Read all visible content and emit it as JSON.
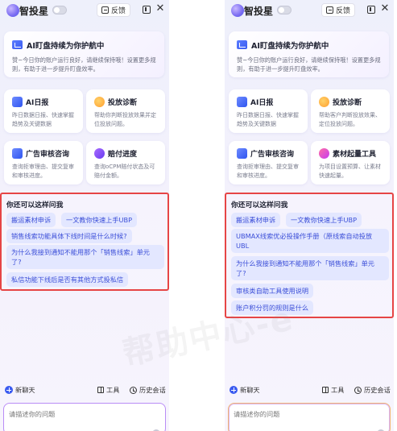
{
  "left": {
    "app_title": "智投星",
    "feedback_label": "反馈",
    "banner": {
      "title": "AI盯盘持续为你护航中",
      "desc": "赞~今日你的账户运行良好，请继续保持哦！设置更多规则，有助于进一步提升盯盘效率。"
    },
    "cards": [
      {
        "title": "AI日报",
        "desc": "昨日数据日报、快速掌握趋势及关键数据",
        "icon": "report-icon"
      },
      {
        "title": "投放诊断",
        "desc": "帮助你判断投放效果并定位投放问题。",
        "icon": "diagnosis-icon"
      },
      {
        "title": "广告审核咨询",
        "desc": "查询拒审理由、提交复审和审核进度。",
        "icon": "review-icon"
      },
      {
        "title": "赔付进度",
        "desc": "查询oCPM赔付状态及可赔付金额。",
        "icon": "compensation-icon"
      }
    ],
    "questions_title": "你还可以这样问我",
    "questions": [
      "搬运素材申诉",
      "一文教你快速上手UBP",
      "销售线索功能具体下线时间是什么时候?",
      "为什么我接到通知不能用那个「销售线索」单元了?",
      "私信功能下线后是否有其他方式投私信"
    ],
    "footer": {
      "new_chat": "新聊天",
      "tools": "工具",
      "history": "历史会话"
    },
    "input_placeholder": "请描述你的问题"
  },
  "right": {
    "app_title": "智投星",
    "feedback_label": "反馈",
    "banner": {
      "title": "AI盯盘持续为你护航中",
      "desc": "赞~今日你的账户运行良好，请继续保持哦！设置更多规则，有助于进一步提升盯盘效率。"
    },
    "cards": [
      {
        "title": "AI日报",
        "desc": "昨日数据日报、快速掌握趋势及关键数据",
        "icon": "report-icon"
      },
      {
        "title": "投放诊断",
        "desc": "帮助客户判断投放效果、定位投放问题。",
        "icon": "diagnosis-icon"
      },
      {
        "title": "广告审核咨询",
        "desc": "查询拒审理由、提交复审和审核进度。",
        "icon": "review-icon"
      },
      {
        "title": "素材起量工具",
        "desc": "为项目设置预算、让素材快速起量。",
        "icon": "material-boost-icon"
      }
    ],
    "questions_title": "你还可以这样问我",
    "questions": [
      "搬运素材申诉",
      "一文教你快速上手UBP",
      "UBMAX线索优必投操作手册（原线索自动投放UBL",
      "为什么我接到通知不能用那个「销售线索」单元了?",
      "审核类自助工具使用说明",
      "账户积分罚的规则是什么"
    ],
    "footer": {
      "new_chat": "新聊天",
      "tools": "工具",
      "history": "历史会话"
    },
    "input_placeholder": "请描述你的问题"
  },
  "watermark": "帮助中心-e"
}
